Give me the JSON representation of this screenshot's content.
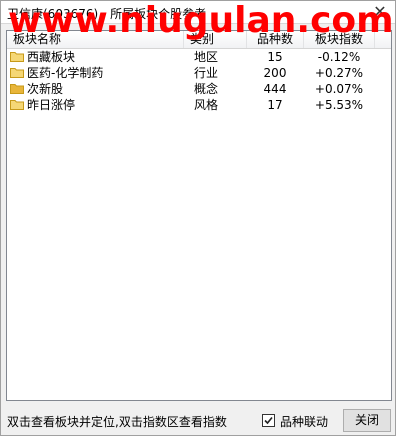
{
  "window": {
    "title": "卫信康(603676) - 所属板块个股参考",
    "close_glyph": "✕"
  },
  "watermark": "www.niugulan.com",
  "table": {
    "headers": [
      "板块名称",
      "类别",
      "品种数",
      "板块指数"
    ],
    "rows": [
      {
        "name": "西藏板块",
        "category": "地区",
        "count": "15",
        "change": "-0.12%",
        "folder_color": "#f5d776"
      },
      {
        "name": "医药-化学制药",
        "category": "行业",
        "count": "200",
        "change": "+0.27%",
        "folder_color": "#f5d776"
      },
      {
        "name": "次新股",
        "category": "概念",
        "count": "444",
        "change": "+0.07%",
        "folder_color": "#e8b53a"
      },
      {
        "name": "昨日涨停",
        "category": "风格",
        "count": "17",
        "change": "+5.53%",
        "folder_color": "#f5d776"
      }
    ]
  },
  "footer": {
    "hint": "双击查看板块并定位,双击指数区查看指数",
    "checkbox_label": "品种联动",
    "checkbox_checked": true,
    "close_label": "关闭"
  },
  "colors": {
    "watermark": "#ff0000",
    "folder_body": "#f5d776",
    "folder_edge": "#c79a1a"
  }
}
